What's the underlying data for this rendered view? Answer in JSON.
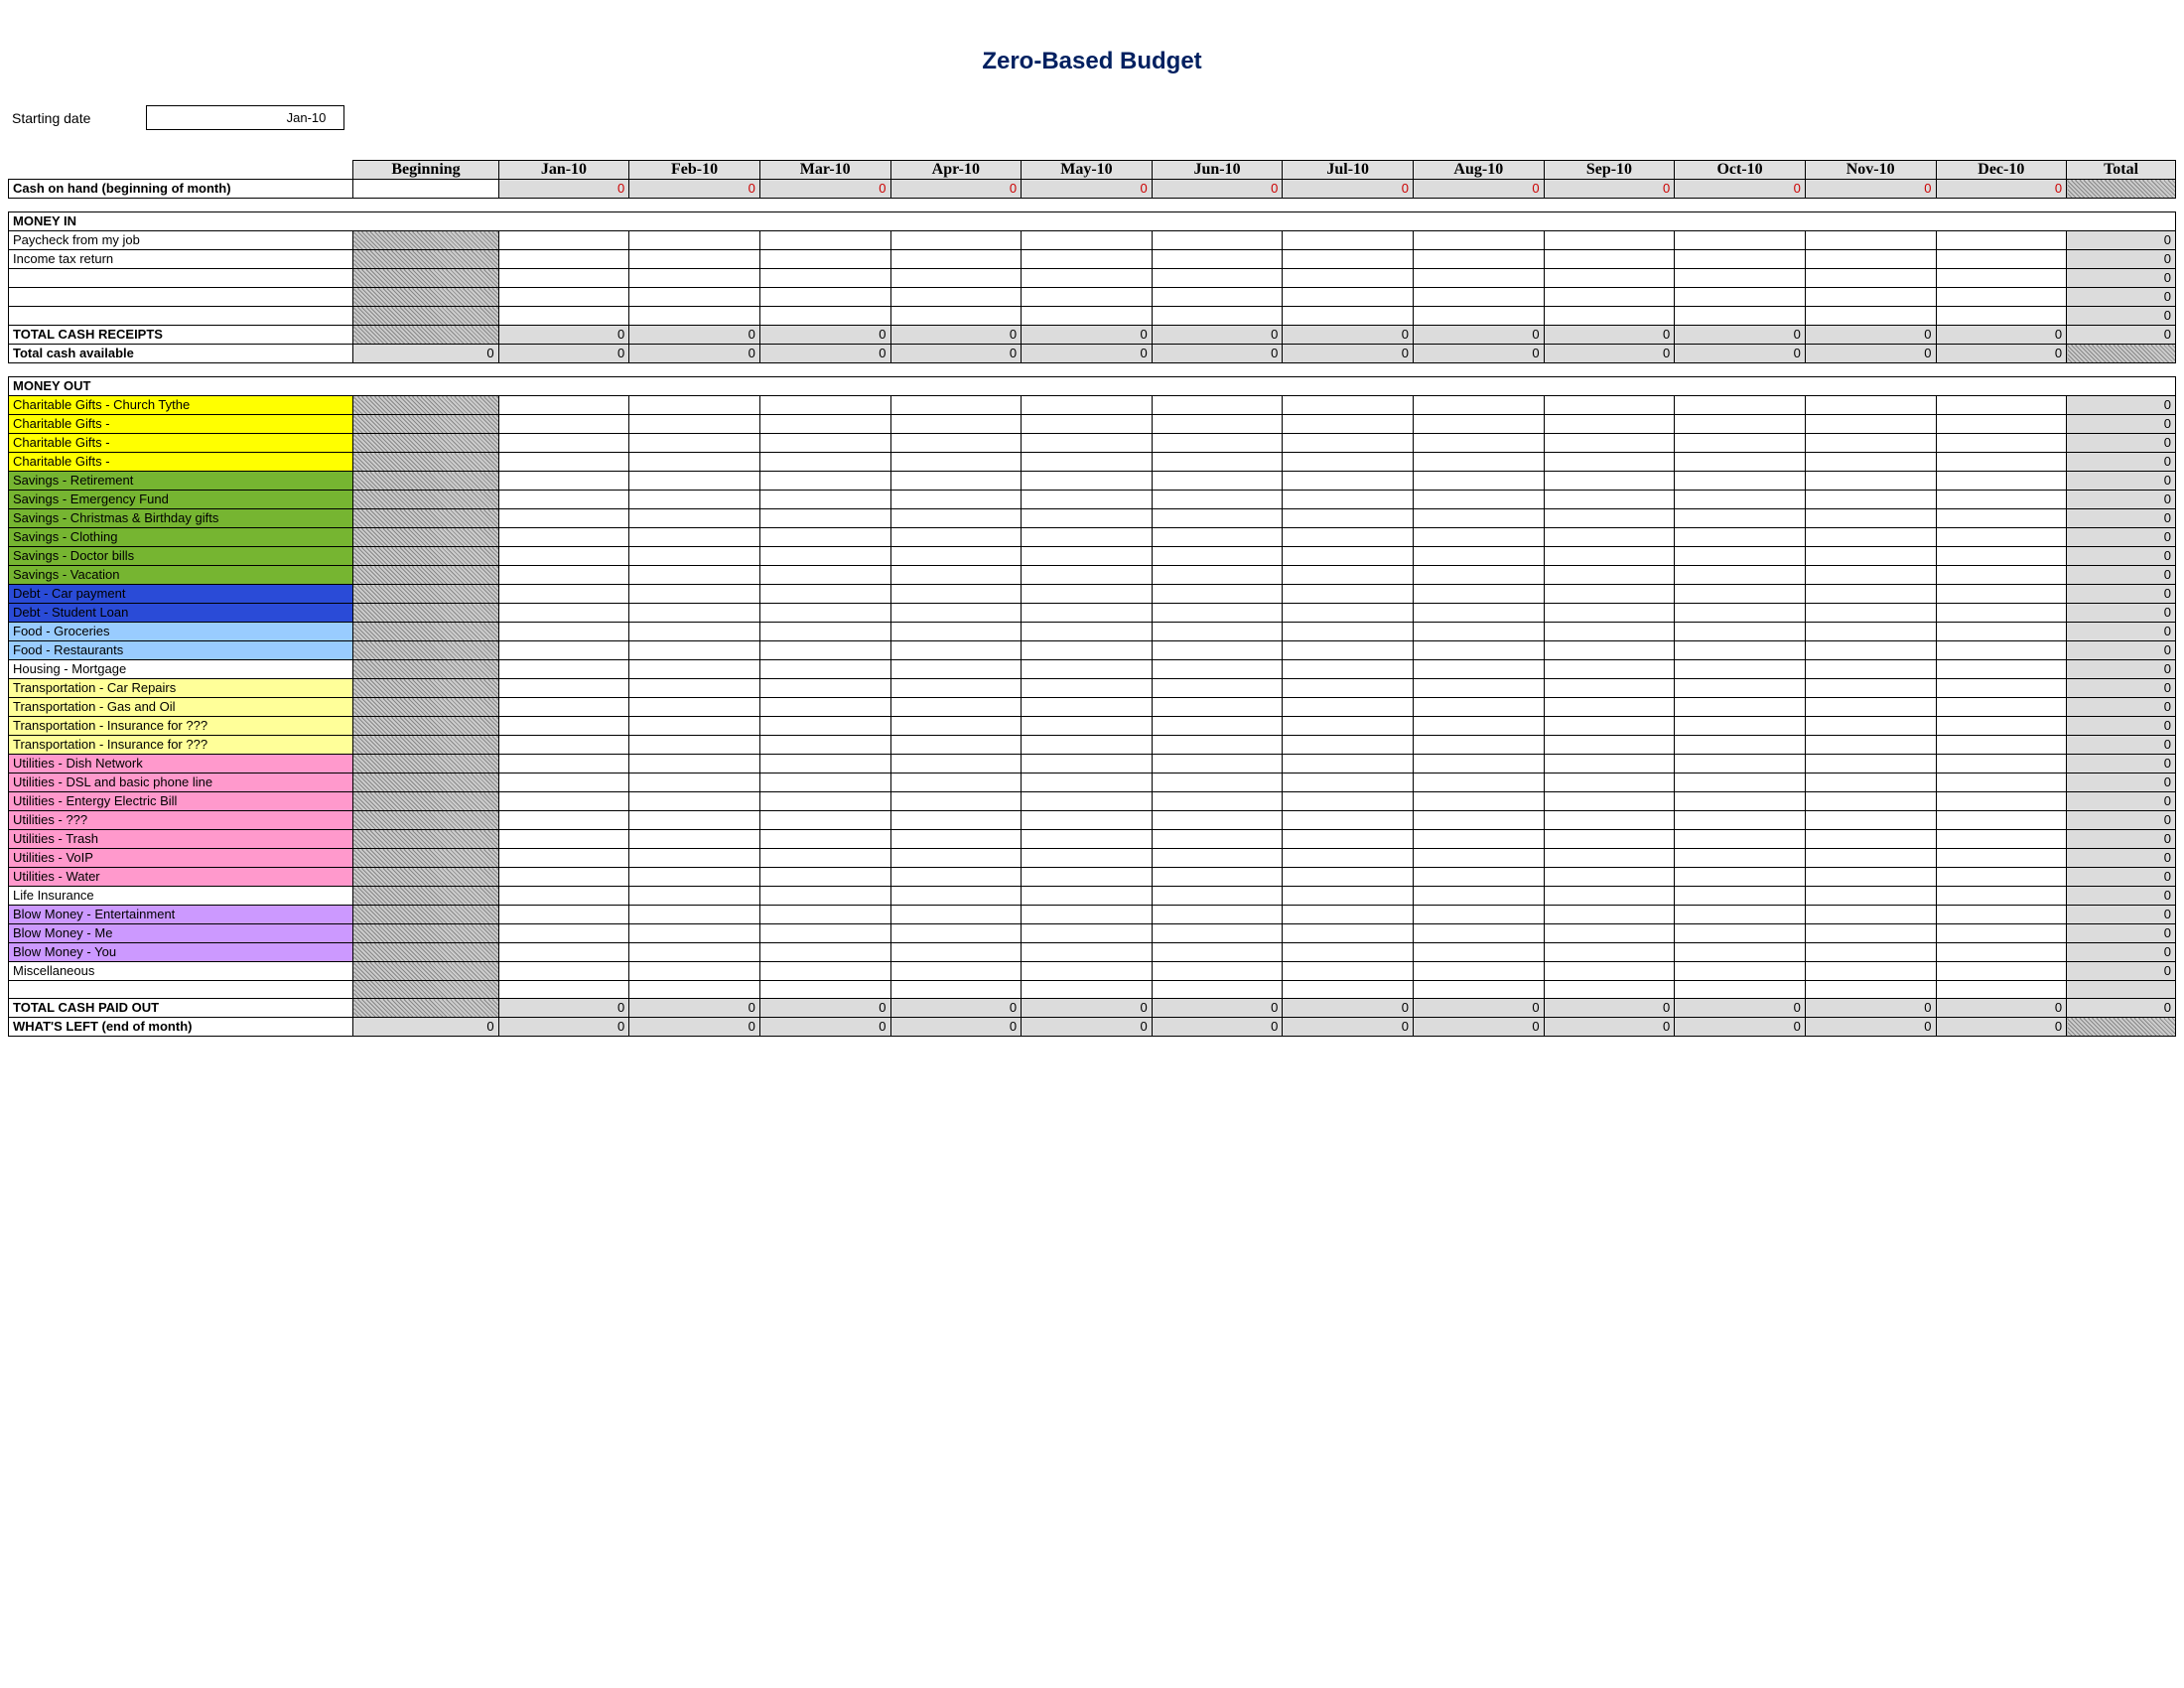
{
  "title": "Zero-Based Budget",
  "starting_date_label": "Starting date",
  "starting_date_value": "Jan-10",
  "columns": {
    "beginning": "Beginning",
    "months": [
      "Jan-10",
      "Feb-10",
      "Mar-10",
      "Apr-10",
      "May-10",
      "Jun-10",
      "Jul-10",
      "Aug-10",
      "Sep-10",
      "Oct-10",
      "Nov-10",
      "Dec-10"
    ],
    "total": "Total"
  },
  "rows": {
    "cash_on_hand": "Cash on hand (beginning of month)",
    "money_in": "MONEY IN",
    "paycheck": "Paycheck from my job",
    "income_tax": "Income tax return",
    "total_receipts": "TOTAL CASH RECEIPTS",
    "total_available": "Total cash available",
    "money_out": "MONEY OUT",
    "total_paid_out": "TOTAL CASH PAID OUT",
    "whats_left": "WHAT'S LEFT (end of month)"
  },
  "categories": [
    {
      "label": "Charitable Gifts - Church Tythe",
      "color": "c-yellow"
    },
    {
      "label": "Charitable Gifts -",
      "color": "c-yellow"
    },
    {
      "label": "Charitable Gifts -",
      "color": "c-yellow"
    },
    {
      "label": "Charitable Gifts -",
      "color": "c-yellow"
    },
    {
      "label": "Savings - Retirement",
      "color": "c-green"
    },
    {
      "label": "Savings - Emergency Fund",
      "color": "c-green"
    },
    {
      "label": "Savings - Christmas & Birthday gifts",
      "color": "c-green"
    },
    {
      "label": "Savings - Clothing",
      "color": "c-green"
    },
    {
      "label": "Savings - Doctor bills",
      "color": "c-green"
    },
    {
      "label": "Savings - Vacation",
      "color": "c-green"
    },
    {
      "label": "Debt - Car payment",
      "color": "c-dblue"
    },
    {
      "label": "Debt - Student Loan",
      "color": "c-dblue"
    },
    {
      "label": "Food - Groceries",
      "color": "c-lblue"
    },
    {
      "label": "Food - Restaurants",
      "color": "c-lblue"
    },
    {
      "label": "Housing - Mortgage",
      "color": "c-white"
    },
    {
      "label": "Transportation - Car Repairs",
      "color": "c-cream"
    },
    {
      "label": "Transportation - Gas and Oil",
      "color": "c-cream"
    },
    {
      "label": "Transportation - Insurance for ???",
      "color": "c-cream"
    },
    {
      "label": "Transportation - Insurance for ???",
      "color": "c-cream"
    },
    {
      "label": "Utilities - Dish Network",
      "color": "c-pink"
    },
    {
      "label": "Utilities - DSL and basic phone line",
      "color": "c-pink"
    },
    {
      "label": "Utilities - Entergy Electric Bill",
      "color": "c-pink"
    },
    {
      "label": "Utilities - ???",
      "color": "c-pink"
    },
    {
      "label": "Utilities - Trash",
      "color": "c-pink"
    },
    {
      "label": "Utilities - VoIP",
      "color": "c-pink"
    },
    {
      "label": "Utilities - Water",
      "color": "c-pink"
    },
    {
      "label": "Life Insurance",
      "color": "c-white"
    },
    {
      "label": "Blow Money - Entertainment",
      "color": "c-purple"
    },
    {
      "label": "Blow Money - Me",
      "color": "c-purple"
    },
    {
      "label": "Blow Money - You",
      "color": "c-purple"
    },
    {
      "label": "Miscellaneous",
      "color": "c-white"
    }
  ],
  "zero": "0"
}
